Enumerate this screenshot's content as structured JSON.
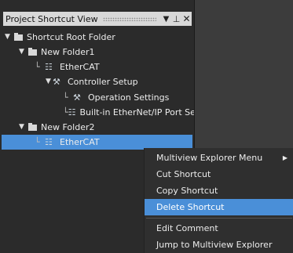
{
  "panel": {
    "title": "Project Shortcut View",
    "pin_icon": "pin-icon",
    "dropdown_icon": "dropdown-arrow-icon",
    "close_icon": "close-icon"
  },
  "tree": {
    "root": "Shortcut Root Folder",
    "folder1": "New Folder1",
    "folder1_ethercat": "EtherCAT",
    "controller_setup": "Controller Setup",
    "operation_settings": "Operation Settings",
    "ethernet_port": "Built-in EtherNet/IP Port Se",
    "folder2": "New Folder2",
    "folder2_ethercat": "EtherCAT"
  },
  "context_menu": {
    "multiview_menu": "Multiview Explorer Menu",
    "cut": "Cut Shortcut",
    "copy": "Copy Shortcut",
    "delete": "Delete Shortcut",
    "edit_comment": "Edit Comment",
    "jump": "Jump to Multiview Explorer"
  },
  "colors": {
    "selection": "#4a8fd8",
    "panel_bg": "#2b2b2b",
    "titlebar_bg": "#d8d8d8"
  }
}
